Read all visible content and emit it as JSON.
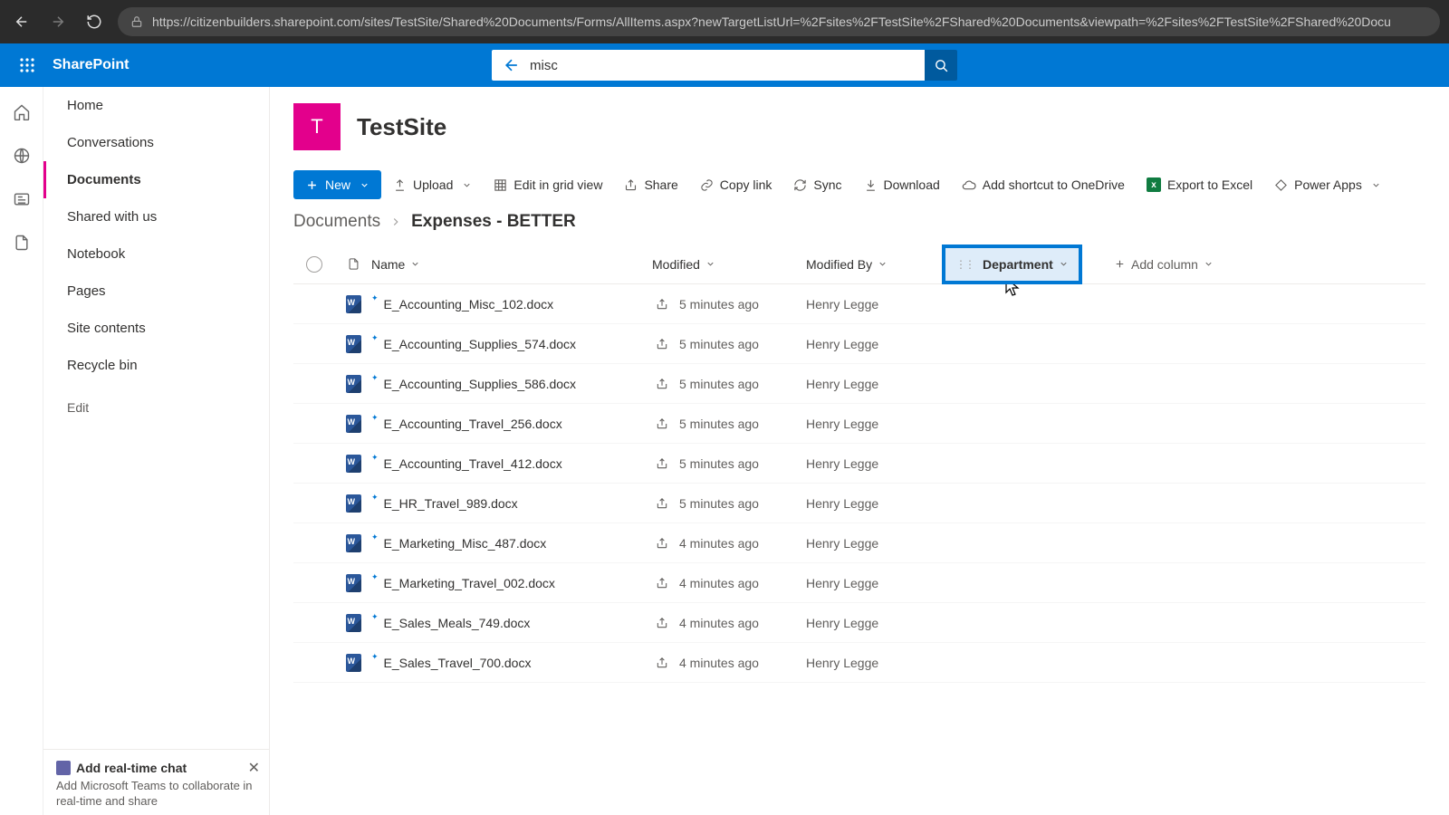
{
  "browser": {
    "url": "https://citizenbuilders.sharepoint.com/sites/TestSite/Shared%20Documents/Forms/AllItems.aspx?newTargetListUrl=%2Fsites%2FTestSite%2FShared%20Documents&viewpath=%2Fsites%2FTestSite%2FShared%20Docu"
  },
  "header": {
    "brand": "SharePoint",
    "search_value": "misc"
  },
  "site": {
    "initial": "T",
    "title": "TestSite"
  },
  "nav": {
    "items": [
      "Home",
      "Conversations",
      "Documents",
      "Shared with us",
      "Notebook",
      "Pages",
      "Site contents",
      "Recycle bin"
    ],
    "active_index": 2,
    "edit": "Edit"
  },
  "chat_card": {
    "title": "Add real-time chat",
    "sub": "Add Microsoft Teams to collaborate in real-time and share"
  },
  "toolbar": {
    "new": "New",
    "upload": "Upload",
    "edit_grid": "Edit in grid view",
    "share": "Share",
    "copy_link": "Copy link",
    "sync": "Sync",
    "download": "Download",
    "shortcut": "Add shortcut to OneDrive",
    "export": "Export to Excel",
    "powerapps": "Power Apps"
  },
  "crumbs": {
    "root": "Documents",
    "current": "Expenses - BETTER"
  },
  "columns": {
    "name": "Name",
    "modified": "Modified",
    "modified_by": "Modified By",
    "department": "Department",
    "add": "Add column"
  },
  "rows": [
    {
      "name": "E_Accounting_Misc_102.docx",
      "modified": "5 minutes ago",
      "by": "Henry Legge"
    },
    {
      "name": "E_Accounting_Supplies_574.docx",
      "modified": "5 minutes ago",
      "by": "Henry Legge"
    },
    {
      "name": "E_Accounting_Supplies_586.docx",
      "modified": "5 minutes ago",
      "by": "Henry Legge"
    },
    {
      "name": "E_Accounting_Travel_256.docx",
      "modified": "5 minutes ago",
      "by": "Henry Legge"
    },
    {
      "name": "E_Accounting_Travel_412.docx",
      "modified": "5 minutes ago",
      "by": "Henry Legge"
    },
    {
      "name": "E_HR_Travel_989.docx",
      "modified": "5 minutes ago",
      "by": "Henry Legge"
    },
    {
      "name": "E_Marketing_Misc_487.docx",
      "modified": "4 minutes ago",
      "by": "Henry Legge"
    },
    {
      "name": "E_Marketing_Travel_002.docx",
      "modified": "4 minutes ago",
      "by": "Henry Legge"
    },
    {
      "name": "E_Sales_Meals_749.docx",
      "modified": "4 minutes ago",
      "by": "Henry Legge"
    },
    {
      "name": "E_Sales_Travel_700.docx",
      "modified": "4 minutes ago",
      "by": "Henry Legge"
    }
  ]
}
